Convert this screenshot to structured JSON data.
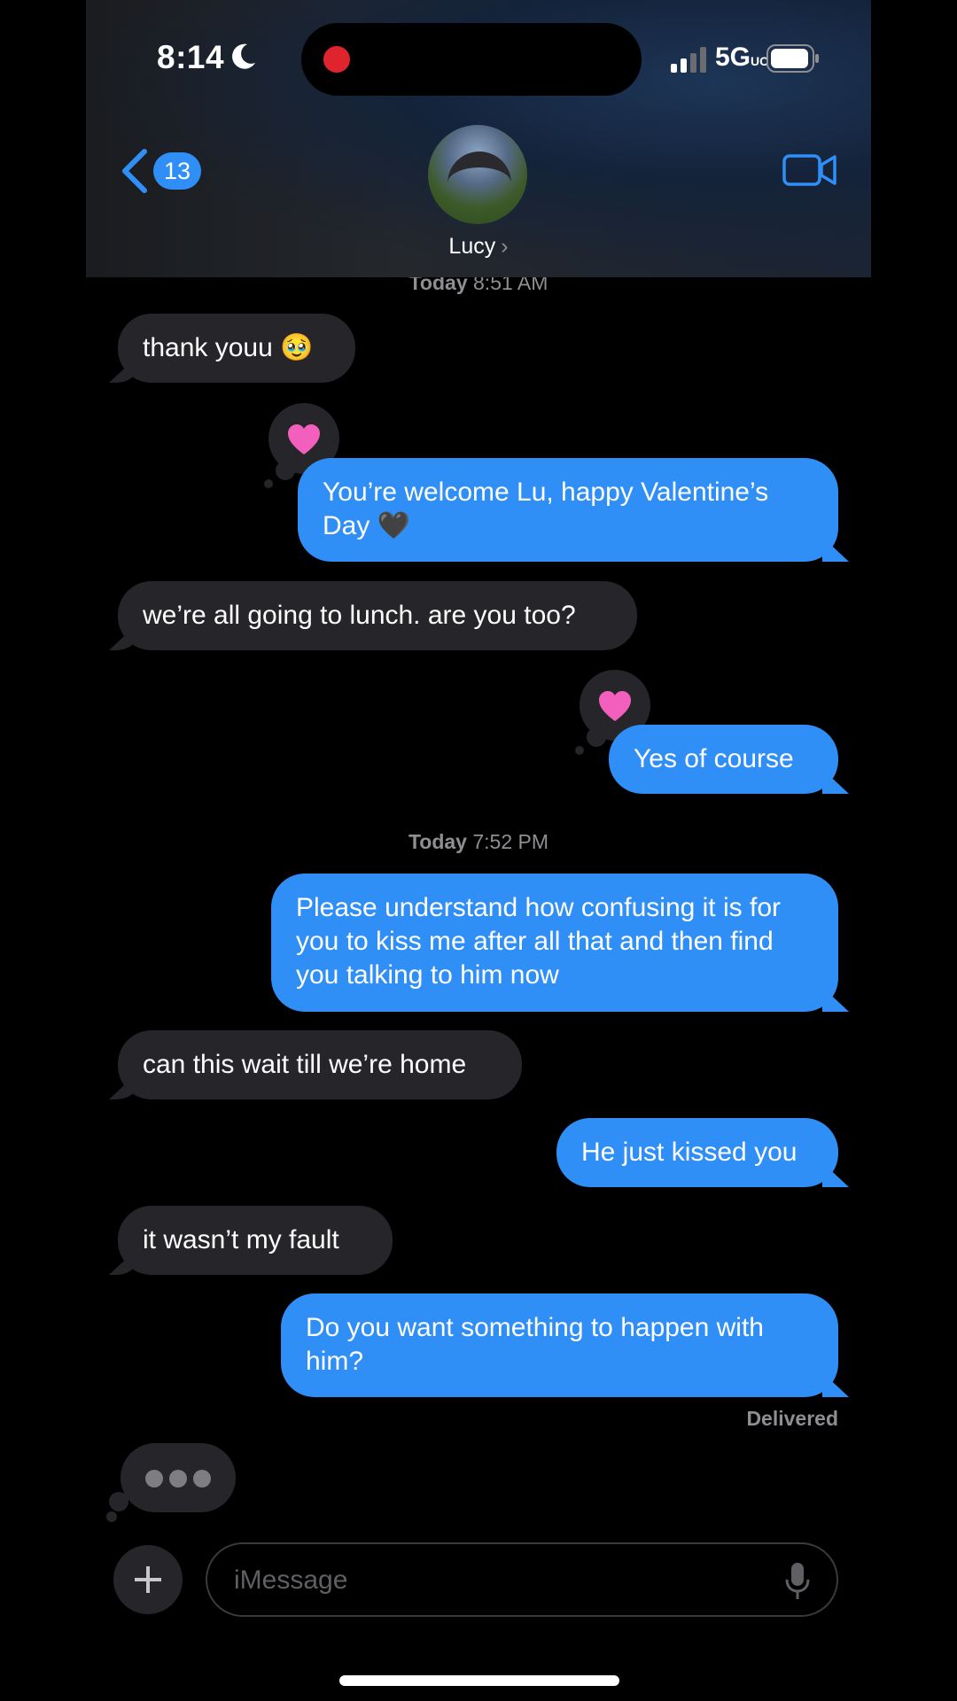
{
  "status_bar": {
    "time": "8:14",
    "network": "5G",
    "network_suffix": "UC"
  },
  "header": {
    "back_count": "13",
    "contact_name": "Lucy",
    "chevron": "›"
  },
  "timestamps": [
    {
      "day": "Today",
      "time": "8:51 AM"
    },
    {
      "day": "Today",
      "time": "7:52 PM"
    }
  ],
  "messages": [
    {
      "dir": "in",
      "text": "thank youu 🥹"
    },
    {
      "dir": "out",
      "text": "You’re welcome Lu, happy Valentine’s Day 🖤",
      "tapback": "heart"
    },
    {
      "dir": "in",
      "text": "we’re all going to lunch. are you too?"
    },
    {
      "dir": "out",
      "text": "Yes of course",
      "tapback": "heart"
    },
    {
      "dir": "out",
      "text": "Please understand how confusing it is for you to kiss me after all that and then find you talking to him now"
    },
    {
      "dir": "in",
      "text": "can this wait till we’re home"
    },
    {
      "dir": "out",
      "text": "He just kissed you"
    },
    {
      "dir": "in",
      "text": "it wasn’t my fault"
    },
    {
      "dir": "out",
      "text": "Do you want something to happen with him?"
    }
  ],
  "delivery_status": "Delivered",
  "composer": {
    "placeholder": "iMessage"
  },
  "colors": {
    "outgoing": "#2f8ff6",
    "incoming": "#26262a",
    "heart": "#f25fbd"
  },
  "icons": [
    "moon-icon",
    "signal-icon",
    "battery-icon",
    "back-chevron-icon",
    "video-call-icon",
    "heart-icon",
    "plus-icon",
    "microphone-icon"
  ]
}
